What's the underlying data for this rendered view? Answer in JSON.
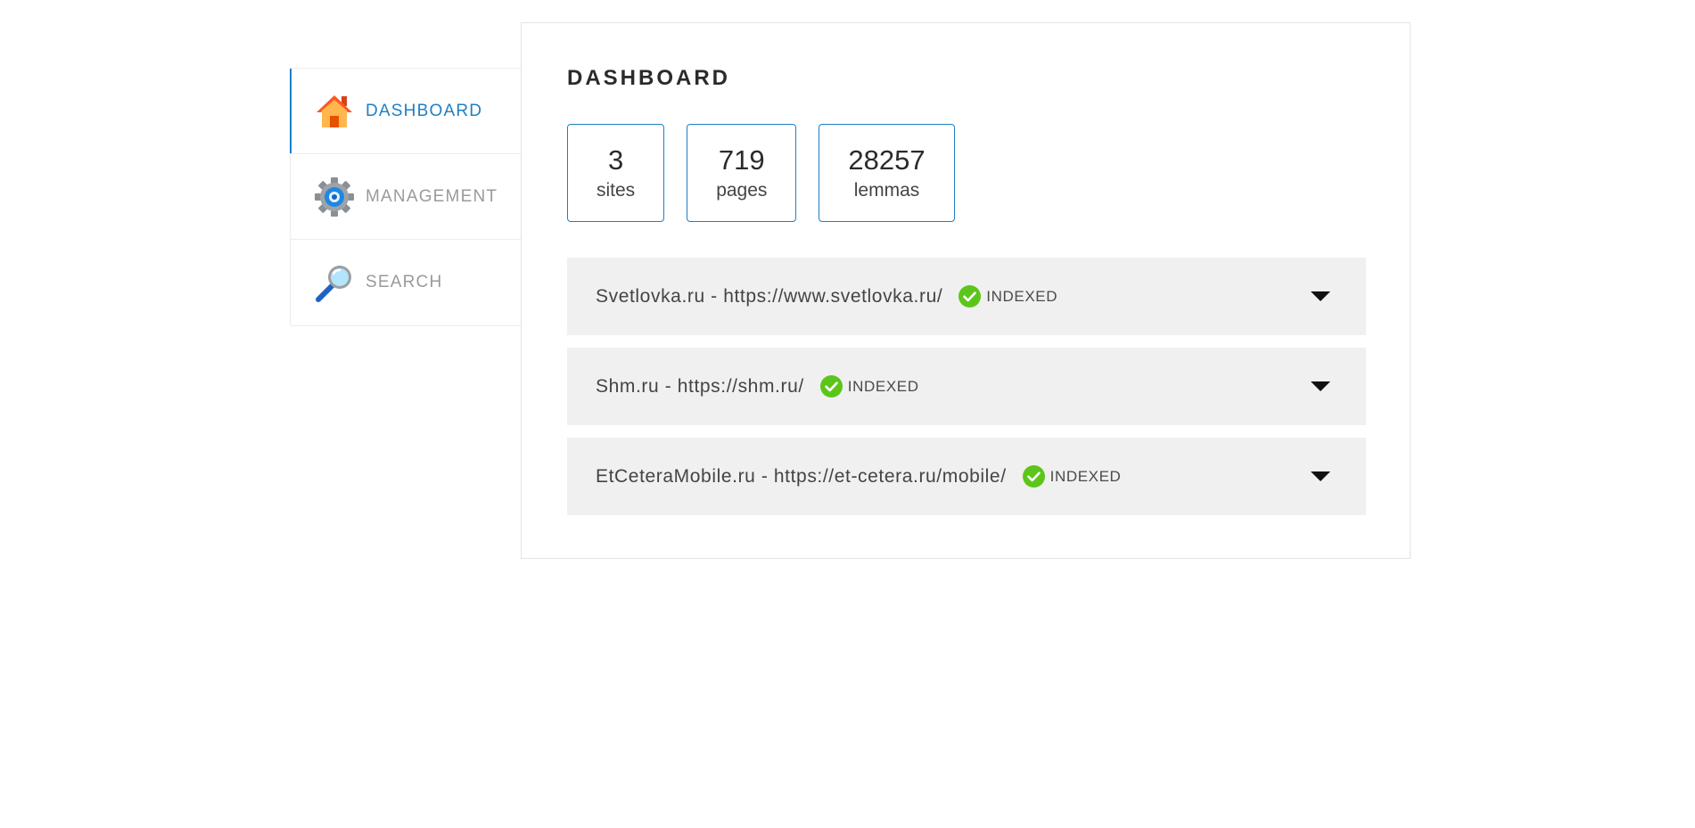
{
  "sidebar": {
    "items": [
      {
        "label": "DASHBOARD",
        "icon": "home-icon",
        "active": true
      },
      {
        "label": "MANAGEMENT",
        "icon": "gear-icon",
        "active": false
      },
      {
        "label": "SEARCH",
        "icon": "magnifier-icon",
        "active": false
      }
    ]
  },
  "main": {
    "title": "DASHBOARD",
    "stats": [
      {
        "value": "3",
        "label": "sites"
      },
      {
        "value": "719",
        "label": "pages"
      },
      {
        "value": "28257",
        "label": "lemmas"
      }
    ],
    "sites": [
      {
        "title": "Svetlovka.ru - https://www.svetlovka.ru/",
        "status": "INDEXED"
      },
      {
        "title": "Shm.ru - https://shm.ru/",
        "status": "INDEXED"
      },
      {
        "title": "EtCeteraMobile.ru - https://et-cetera.ru/mobile/",
        "status": "INDEXED"
      }
    ]
  },
  "colors": {
    "accent": "#1f7fc4",
    "status_ok": "#5cc51a",
    "row_bg": "#f0f0f0"
  }
}
